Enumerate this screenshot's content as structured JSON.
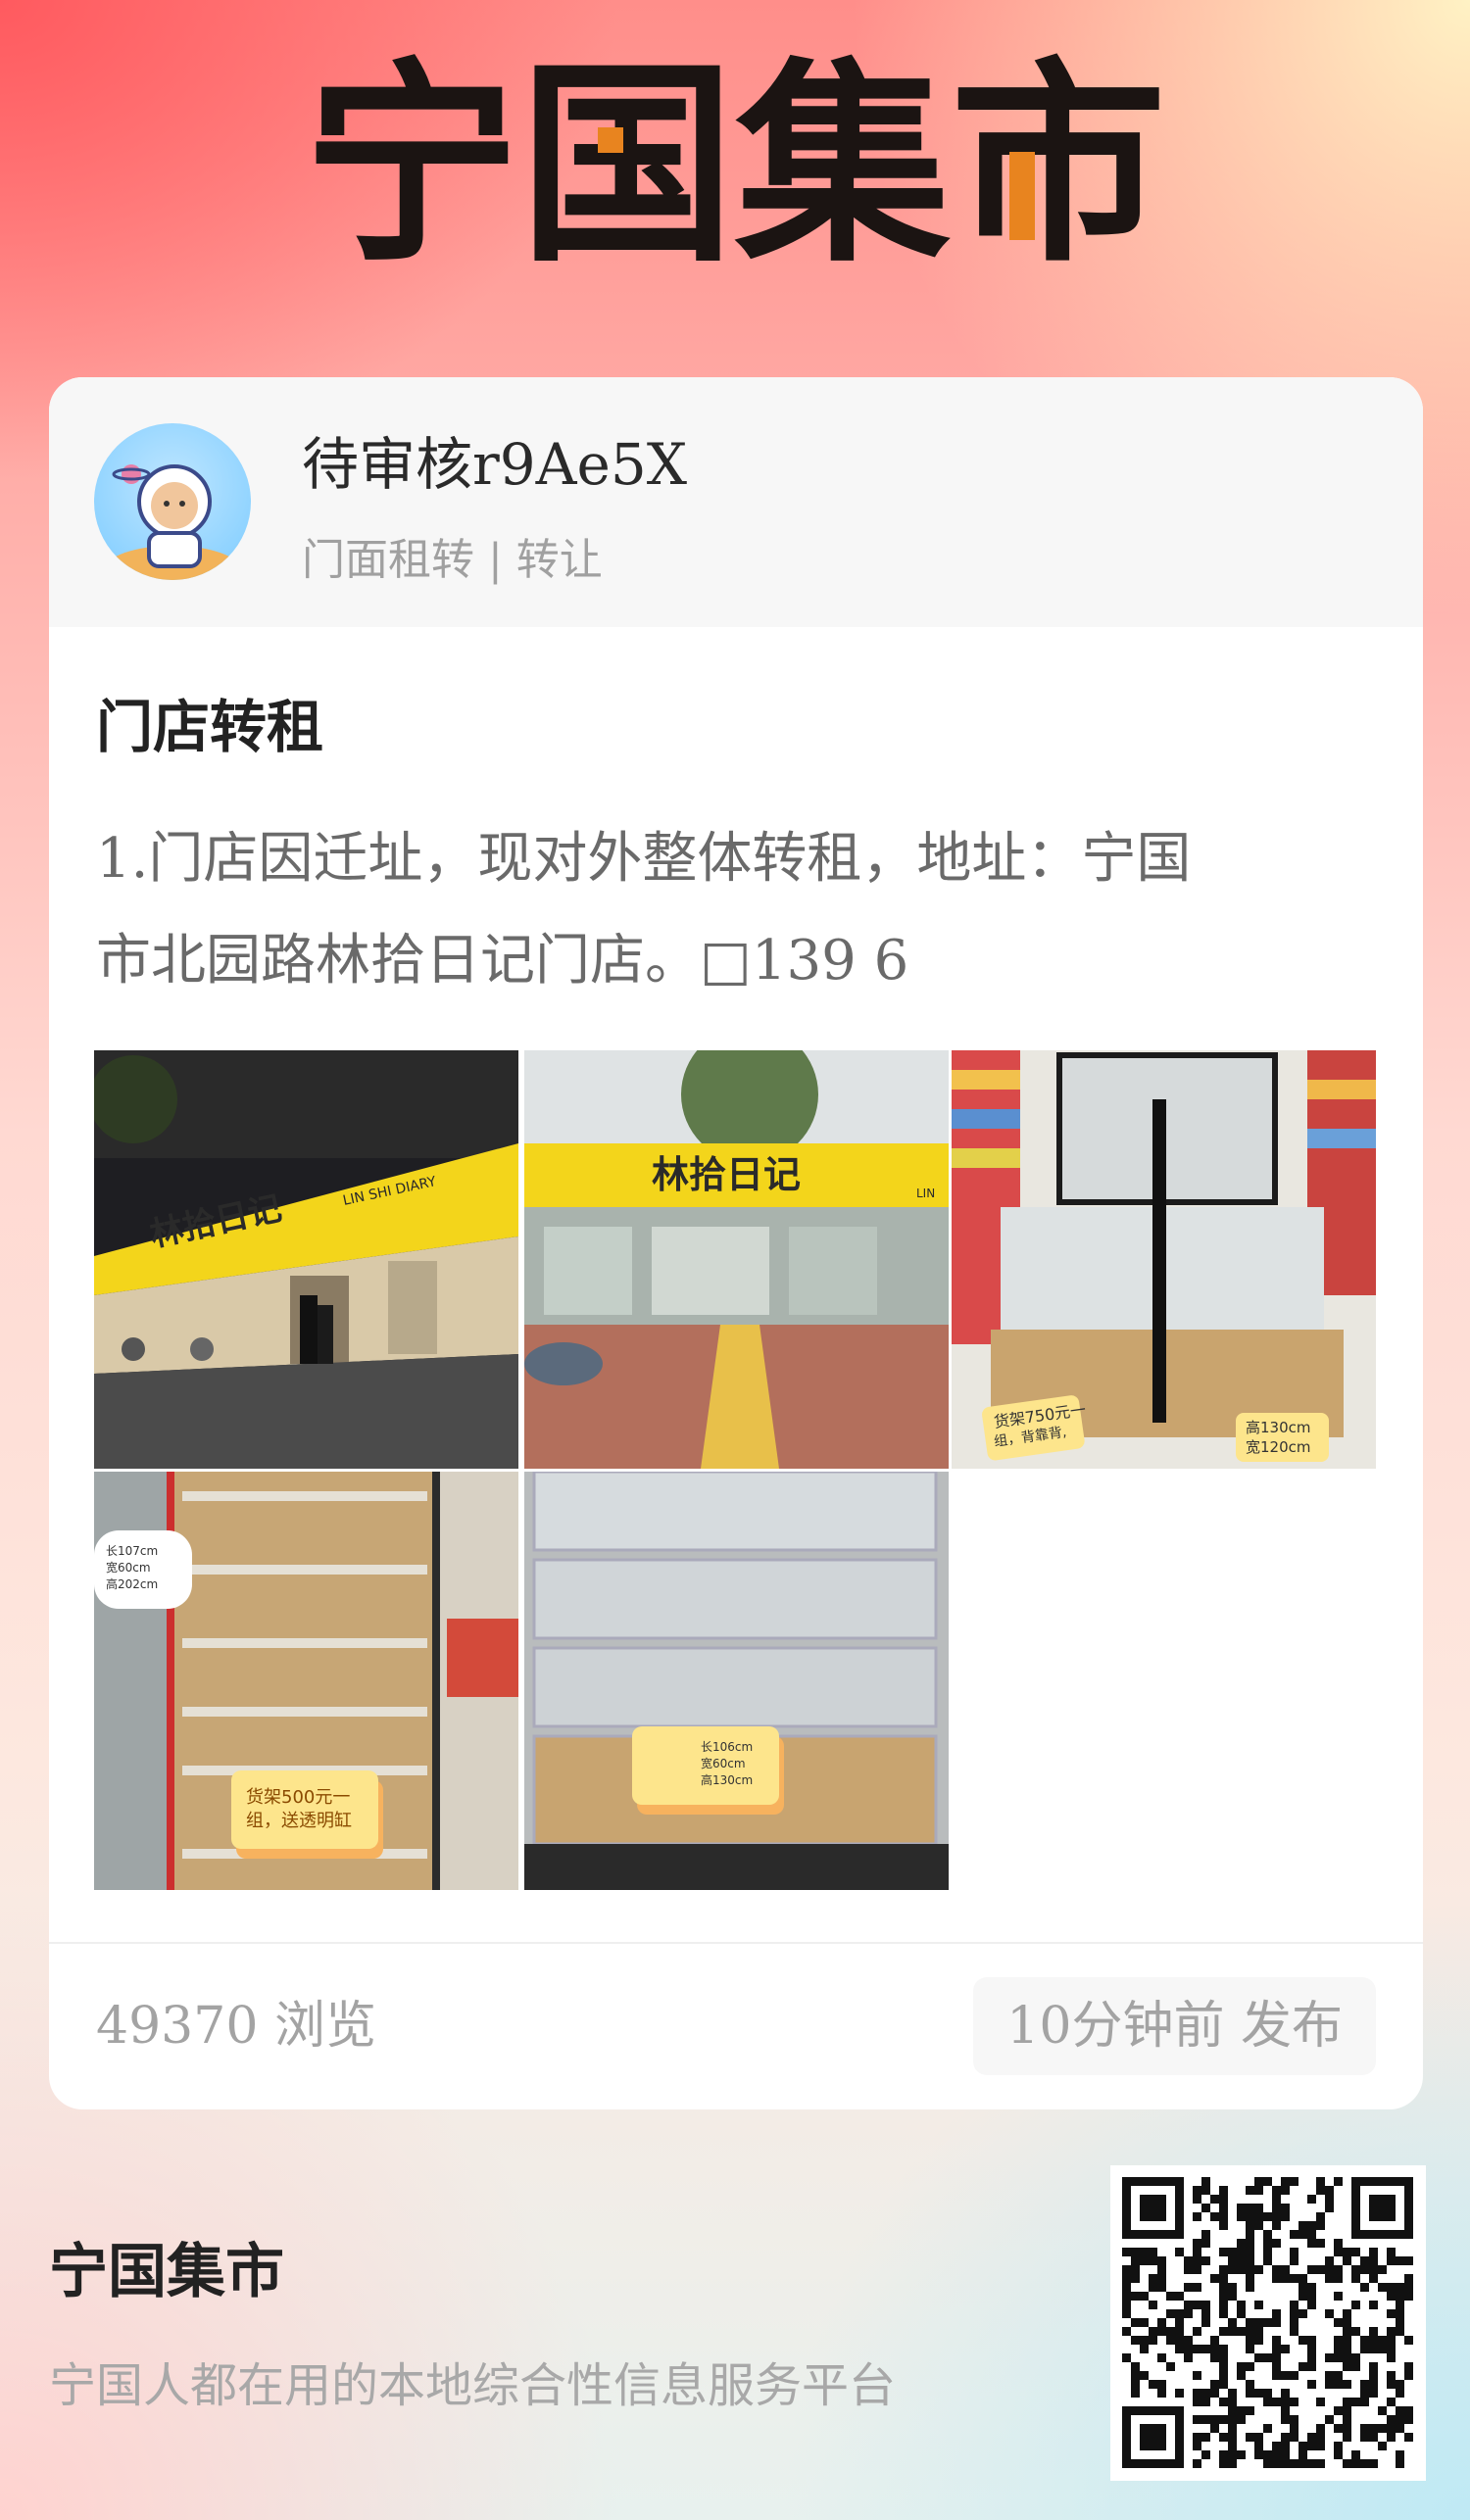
{
  "brand": {
    "logo_text": "宁国集市"
  },
  "post": {
    "user_name": "待审核r9Ae5X",
    "category": "门面租转 | 转让",
    "title": "门店转租",
    "body_line1": "1.门店因迁址，现对外整体转租，地址：宁国",
    "body_line2": "市北园路林拾日记门店。□139 6",
    "photos": [
      {
        "name": "storefront-night-photo",
        "sign_text": "林拾日记",
        "sign_sub": "LIN SHI DIARY"
      },
      {
        "name": "storefront-day-photo",
        "sign_text": "林拾日记",
        "sign_sub": "LIN"
      },
      {
        "name": "shelf-island-photo",
        "tag1": "货架750元一",
        "tag1b": "组，背靠背,",
        "tag2": "高130cm",
        "tag2b": "宽120cm"
      },
      {
        "name": "wall-shelf-photo",
        "size1": "长107cm",
        "size2": "宽60cm",
        "size3": "高202cm",
        "tag": "货架500元一",
        "tagb": "组，送透明缸"
      },
      {
        "name": "acrylic-bins-photo",
        "size1": "长106cm",
        "size2": "宽60cm",
        "size3": "高130cm"
      }
    ],
    "views": "49370 浏览",
    "published": "10分钟前 发布"
  },
  "footer": {
    "title": "宁国集市",
    "subtitle": "宁国人都在用的本地综合性信息服务平台"
  },
  "colors": {
    "accent_orange": "#e8841f",
    "sign_yellow": "#f3d51b",
    "text_dark": "#222222",
    "text_muted": "#a3a3a3"
  }
}
